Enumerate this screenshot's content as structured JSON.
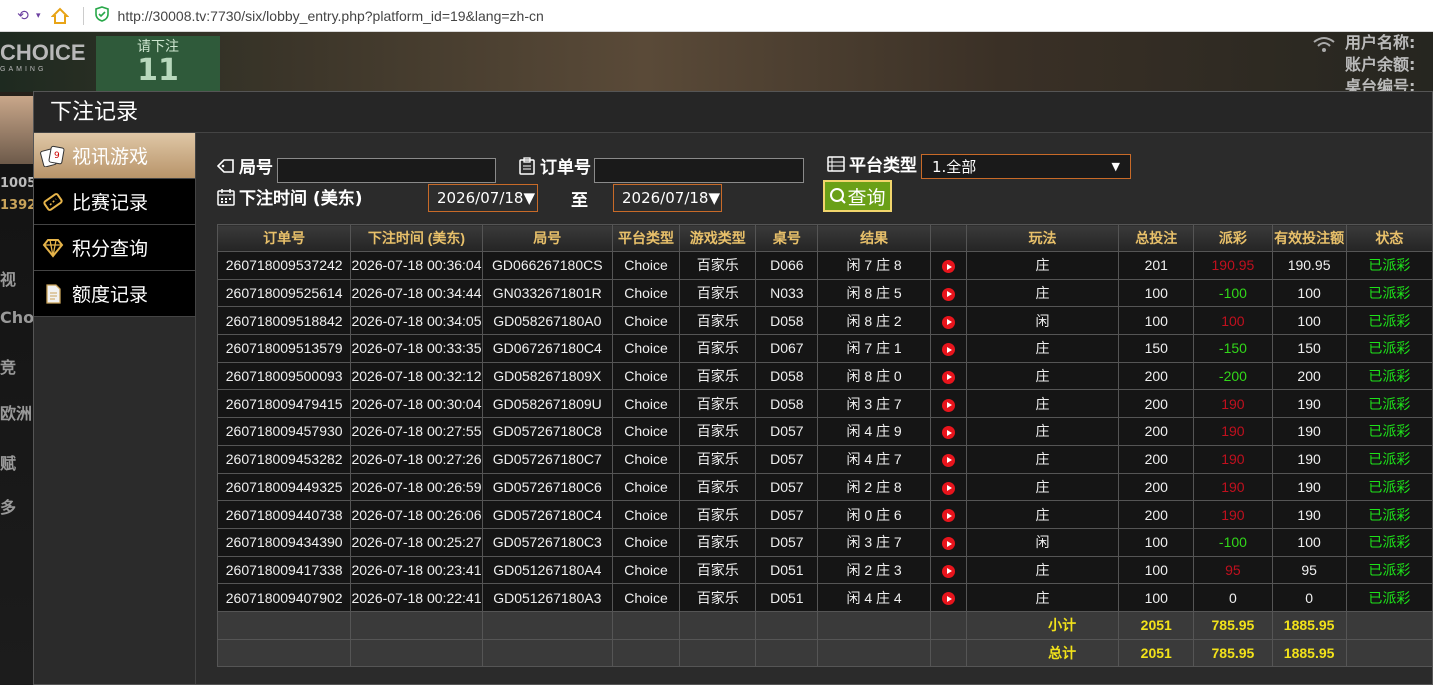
{
  "browser": {
    "url": "http://30008.tv:7730/six/lobby_entry.php?platform_id=19&lang=zh-cn"
  },
  "background": {
    "logo_text": "CHOICE",
    "logo_sub": "GAMING",
    "bet_label": "请下注",
    "bet_count": "11",
    "right_lines": [
      "用户名称:",
      "账户余额:",
      "桌台编号:"
    ],
    "side_nums": [
      "1005",
      "1392"
    ],
    "side_texts": [
      "视",
      "Cho",
      "竞",
      "欧洲",
      "赋",
      "多"
    ]
  },
  "modal": {
    "title": "下注记录"
  },
  "sidebar": {
    "items": [
      {
        "label": "视讯游戏",
        "icon": "cards-icon",
        "active": true
      },
      {
        "label": "比赛记录",
        "icon": "ticket-icon",
        "active": false
      },
      {
        "label": "积分查询",
        "icon": "diamond-icon",
        "active": false
      },
      {
        "label": "额度记录",
        "icon": "document-icon",
        "active": false
      }
    ]
  },
  "filters": {
    "round_label": "局号",
    "order_label": "订单号",
    "platform_label": "平台类型",
    "platform_value": "1.全部",
    "time_label": "下注时间 (美东)",
    "date_from": "2026/07/18",
    "to_label": "至",
    "date_to": "2026/07/18",
    "query_label": "查询"
  },
  "table": {
    "headers": [
      "订单号",
      "下注时间 (美东)",
      "局号",
      "平台类型",
      "游戏类型",
      "桌号",
      "结果",
      "",
      "玩法",
      "总投注",
      "派彩",
      "有效投注额",
      "状态"
    ],
    "rows": [
      [
        "260718009537242",
        "2026-07-18 00:36:04",
        "GD066267180CS",
        "Choice",
        "百家乐",
        "D066",
        "闲 7 庄 8",
        "庄",
        "201",
        "190.95",
        "190.95",
        "已派彩"
      ],
      [
        "260718009525614",
        "2026-07-18 00:34:44",
        "GN0332671801R",
        "Choice",
        "百家乐",
        "N033",
        "闲 8 庄 5",
        "庄",
        "100",
        "-100",
        "100",
        "已派彩"
      ],
      [
        "260718009518842",
        "2026-07-18 00:34:05",
        "GD058267180A0",
        "Choice",
        "百家乐",
        "D058",
        "闲 8 庄 2",
        "闲",
        "100",
        "100",
        "100",
        "已派彩"
      ],
      [
        "260718009513579",
        "2026-07-18 00:33:35",
        "GD067267180C4",
        "Choice",
        "百家乐",
        "D067",
        "闲 7 庄 1",
        "庄",
        "150",
        "-150",
        "150",
        "已派彩"
      ],
      [
        "260718009500093",
        "2026-07-18 00:32:12",
        "GD0582671809X",
        "Choice",
        "百家乐",
        "D058",
        "闲 8 庄 0",
        "庄",
        "200",
        "-200",
        "200",
        "已派彩"
      ],
      [
        "260718009479415",
        "2026-07-18 00:30:04",
        "GD0582671809U",
        "Choice",
        "百家乐",
        "D058",
        "闲 3 庄 7",
        "庄",
        "200",
        "190",
        "190",
        "已派彩"
      ],
      [
        "260718009457930",
        "2026-07-18 00:27:55",
        "GD057267180C8",
        "Choice",
        "百家乐",
        "D057",
        "闲 4 庄 9",
        "庄",
        "200",
        "190",
        "190",
        "已派彩"
      ],
      [
        "260718009453282",
        "2026-07-18 00:27:26",
        "GD057267180C7",
        "Choice",
        "百家乐",
        "D057",
        "闲 4 庄 7",
        "庄",
        "200",
        "190",
        "190",
        "已派彩"
      ],
      [
        "260718009449325",
        "2026-07-18 00:26:59",
        "GD057267180C6",
        "Choice",
        "百家乐",
        "D057",
        "闲 2 庄 8",
        "庄",
        "200",
        "190",
        "190",
        "已派彩"
      ],
      [
        "260718009440738",
        "2026-07-18 00:26:06",
        "GD057267180C4",
        "Choice",
        "百家乐",
        "D057",
        "闲 0 庄 6",
        "庄",
        "200",
        "190",
        "190",
        "已派彩"
      ],
      [
        "260718009434390",
        "2026-07-18 00:25:27",
        "GD057267180C3",
        "Choice",
        "百家乐",
        "D057",
        "闲 3 庄 7",
        "闲",
        "100",
        "-100",
        "100",
        "已派彩"
      ],
      [
        "260718009417338",
        "2026-07-18 00:23:41",
        "GD051267180A4",
        "Choice",
        "百家乐",
        "D051",
        "闲 2 庄 3",
        "庄",
        "100",
        "95",
        "95",
        "已派彩"
      ],
      [
        "260718009407902",
        "2026-07-18 00:22:41",
        "GD051267180A3",
        "Choice",
        "百家乐",
        "D051",
        "闲 4 庄 4",
        "庄",
        "100",
        "0",
        "0",
        "已派彩"
      ]
    ],
    "subtotal": {
      "label": "小计",
      "total_bet": "2051",
      "payout": "785.95",
      "valid_bet": "1885.95"
    },
    "grand_total": {
      "label": "总计",
      "total_bet": "2051",
      "payout": "785.95",
      "valid_bet": "1885.95"
    }
  },
  "colors": {
    "header_text": "#e8c06a",
    "payout_win": "#c0101e",
    "payout_loss": "#32d61a",
    "status": "#1ee21a",
    "totals": "#f2e21a",
    "accent_border": "#c86a28",
    "query_button": "#6aa017"
  }
}
